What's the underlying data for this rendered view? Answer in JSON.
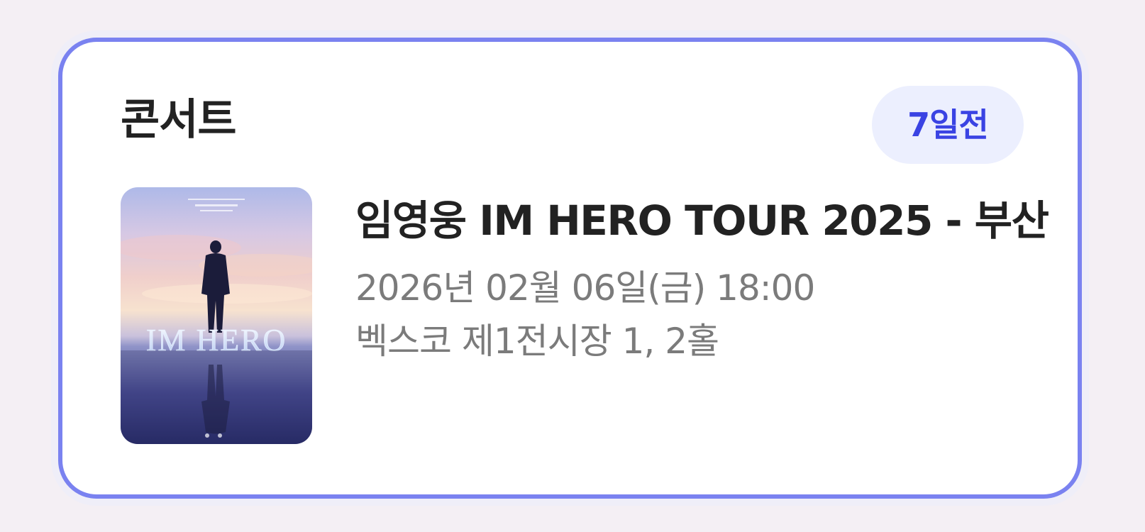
{
  "event": {
    "category": "콘서트",
    "dday": "7일전",
    "title": "임영웅 IM HERO TOUR 2025 - 부산",
    "datetime": "2026년 02월 06일(금) 18:00",
    "venue": "벡스코 제1전시장 1, 2홀",
    "poster": {
      "headline": "IM HERO",
      "colors": {
        "sky_top": "#b9c4ea",
        "sky_glow": "#f1d7cc",
        "water": "#3b3f86",
        "water_deep": "#1e2255"
      }
    }
  },
  "colors": {
    "accent": "#3a43e3",
    "card_border": "#7a82f0",
    "badge_bg": "#eceffe",
    "title": "#222222",
    "secondary_text": "#7b7b7b"
  }
}
